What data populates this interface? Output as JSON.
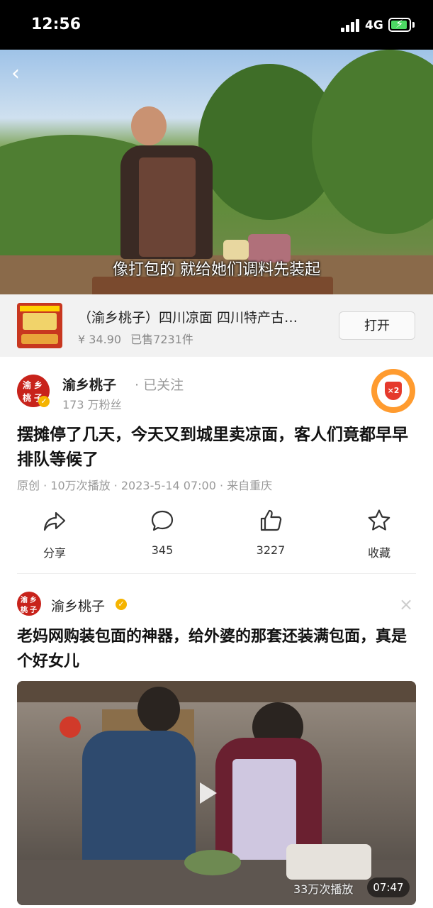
{
  "status_bar": {
    "time": "12:56",
    "network": "4G"
  },
  "video": {
    "subtitle": "像打包的 就给她们调料先装起"
  },
  "product": {
    "title": "（渝乡桃子）四川凉面 四川特产古…",
    "price": "¥ 34.90",
    "sold": "已售7231件",
    "open_label": "打开"
  },
  "author": {
    "name": "渝乡桃子",
    "follow_status": "· 已关注",
    "fans": "173 万粉丝",
    "reward_badge": "×2"
  },
  "post": {
    "title": "摆摊停了几天，今天又到城里卖凉面，客人们竟都早早排队等候了",
    "meta": "原创 · 10万次播放 · 2023-5-14 07:00 · 来自重庆"
  },
  "actions": [
    {
      "label": "分享",
      "icon": "share-icon"
    },
    {
      "label": "345",
      "icon": "comment-icon"
    },
    {
      "label": "3227",
      "icon": "like-icon"
    },
    {
      "label": "收藏",
      "icon": "star-icon"
    }
  ],
  "related": {
    "author_name": "渝乡桃子",
    "title": "老妈网购装包面的神器，给外婆的那套还装满包面，真是个好女儿",
    "plays": "33万次播放",
    "duration": "07:47"
  },
  "colors": {
    "status_bar_bg": "#000000",
    "accent_red": "#c8231b",
    "verified_gold": "#f5b400",
    "battery_green": "#4cd964"
  }
}
